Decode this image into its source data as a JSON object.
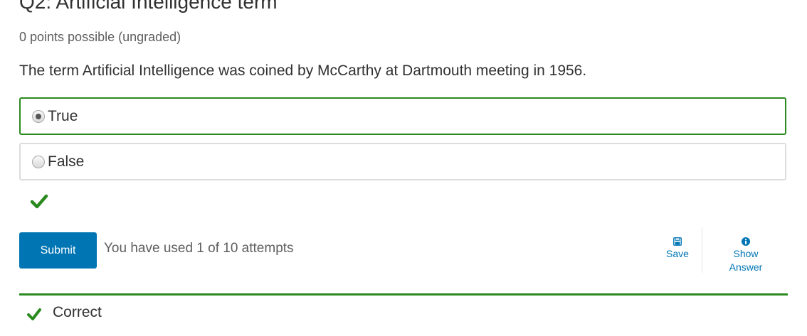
{
  "question": {
    "title": "Q2: Artificial Intelligence term",
    "points": "0 points possible (ungraded)",
    "prompt": "The term Artificial Intelligence was coined by McCarthy at Dartmouth meeting in 1956.",
    "choices": [
      {
        "label": "True",
        "selected": true
      },
      {
        "label": "False",
        "selected": false
      }
    ]
  },
  "status": {
    "icon": "checkmark-icon",
    "color": "#2b8a1f"
  },
  "actions": {
    "submit_label": "Submit",
    "attempts_text": "You have used 1 of 10 attempts",
    "save_label": "Save",
    "show_answer_line1": "Show",
    "show_answer_line2": "Answer"
  },
  "notification": {
    "text": "Correct",
    "icon": "checkmark-icon"
  },
  "colors": {
    "accent": "#0075b4",
    "correct": "#2b8a1f"
  }
}
